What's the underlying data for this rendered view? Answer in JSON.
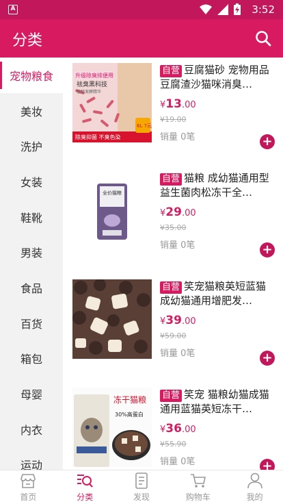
{
  "status_bar": {
    "time": "3:52"
  },
  "appbar": {
    "title": "分类"
  },
  "sidebar": {
    "items": [
      {
        "label": "宠物粮食"
      },
      {
        "label": "美妆"
      },
      {
        "label": "洗护"
      },
      {
        "label": "女装"
      },
      {
        "label": "鞋靴"
      },
      {
        "label": "男装"
      },
      {
        "label": "食品"
      },
      {
        "label": "百货"
      },
      {
        "label": "箱包"
      },
      {
        "label": "母婴"
      },
      {
        "label": "内衣"
      },
      {
        "label": "运动"
      }
    ]
  },
  "products": [
    {
      "tag": "自营",
      "name": "豆腐猫砂 宠物用品豆腐渣沙猫咪消臭…",
      "price_symbol": "¥",
      "price_int": "13",
      "price_dec": ".00",
      "orig_price": "¥19.00",
      "sales": "销量 0笔"
    },
    {
      "tag": "自营",
      "name": "猫粮 成幼猫通用型益生菌肉松冻干全…",
      "price_symbol": "¥",
      "price_int": "29",
      "price_dec": ".00",
      "orig_price": "¥35.00",
      "sales": "销量 0笔"
    },
    {
      "tag": "自营",
      "name": "笑宠猫粮英短蓝猫成幼猫通用增肥发…",
      "price_symbol": "¥",
      "price_int": "39",
      "price_dec": ".00",
      "orig_price": "¥59.00",
      "sales": "销量 0笔"
    },
    {
      "tag": "自营",
      "name": "笑宠 猫粮幼猫成猫通用蓝猫英短冻干…",
      "price_symbol": "¥",
      "price_int": "36",
      "price_dec": ".00",
      "orig_price": "¥55.90",
      "sales": "销量 0笔"
    }
  ],
  "product_images": {
    "p1": {
      "line1": "升级除臭排便用",
      "line2": "祛臭黑科技",
      "line3": "植物发酵精华",
      "bottom": "除臭抑菌  不臭色染",
      "badge": "6L 7元"
    },
    "p2": {
      "bag_label": "全价猫粮"
    },
    "p4": {
      "title": "冻干猫粮",
      "sub": "30%高蛋白"
    }
  },
  "tabbar": {
    "items": [
      {
        "label": "首页"
      },
      {
        "label": "分类"
      },
      {
        "label": "发现"
      },
      {
        "label": "购物车"
      },
      {
        "label": "我的"
      }
    ]
  },
  "colors": {
    "primary": "#d81b60",
    "status_bar": "#c2185b"
  }
}
